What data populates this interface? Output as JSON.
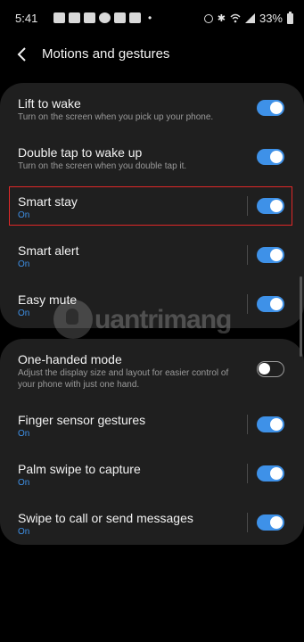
{
  "status_bar": {
    "time": "5:41",
    "battery": "33%",
    "left_icons": [
      "facebook-icon",
      "facebook-icon",
      "facebook-icon",
      "messenger-icon",
      "gallery-icon",
      "email-icon"
    ],
    "right_icons": [
      "alarm-icon",
      "bluetooth-icon",
      "wifi-icon",
      "signal-icon",
      "battery-icon"
    ]
  },
  "header": {
    "title": "Motions and gestures"
  },
  "group1": [
    {
      "title": "Lift to wake",
      "subtitle": "Turn on the screen when you pick up your phone.",
      "toggle": "on"
    },
    {
      "title": "Double tap to wake up",
      "subtitle": "Turn on the screen when you double tap it.",
      "toggle": "on"
    },
    {
      "title": "Smart stay",
      "subtitle": "On",
      "toggle": "on"
    },
    {
      "title": "Smart alert",
      "subtitle": "On",
      "toggle": "on"
    },
    {
      "title": "Easy mute",
      "subtitle": "On",
      "toggle": "on"
    }
  ],
  "group2": [
    {
      "title": "One-handed mode",
      "subtitle": "Adjust the display size and layout for easier control of your phone with just one hand.",
      "toggle": "off"
    },
    {
      "title": "Finger sensor gestures",
      "subtitle": "On",
      "toggle": "on"
    },
    {
      "title": "Palm swipe to capture",
      "subtitle": "On",
      "toggle": "on"
    },
    {
      "title": "Swipe to call or send messages",
      "subtitle": "On",
      "toggle": "on"
    }
  ],
  "watermark": "uantrimang",
  "colors": {
    "accent": "#3e91e8",
    "highlight": "#e02828",
    "card": "#1f1f1f"
  }
}
